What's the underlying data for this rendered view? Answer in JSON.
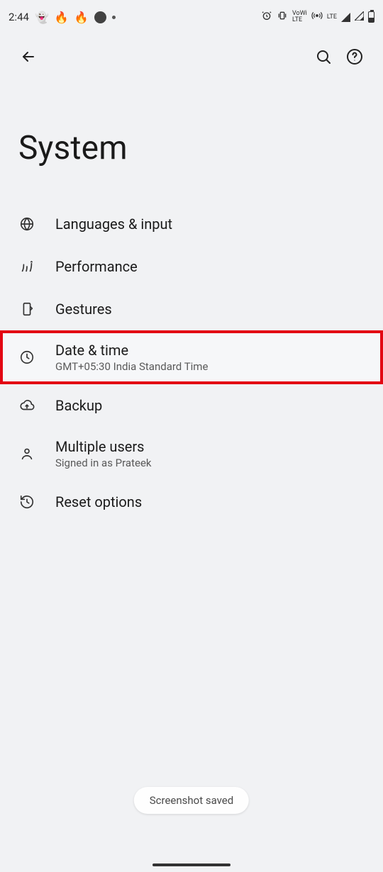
{
  "status": {
    "time": "2:44",
    "lte": "LTE",
    "wifi_small": "Wi‑Fi"
  },
  "appbar": {
    "back": "Back",
    "search": "Search",
    "help": "Help"
  },
  "page": {
    "title": "System"
  },
  "items": [
    {
      "label": "Languages & input",
      "sub": null
    },
    {
      "label": "Performance",
      "sub": null
    },
    {
      "label": "Gestures",
      "sub": null
    },
    {
      "label": "Date & time",
      "sub": "GMT+05:30 India Standard Time"
    },
    {
      "label": "Backup",
      "sub": null
    },
    {
      "label": "Multiple users",
      "sub": "Signed in as Prateek"
    },
    {
      "label": "Reset options",
      "sub": null
    }
  ],
  "toast": {
    "text": "Screenshot saved"
  },
  "highlight_color": "#e30613"
}
